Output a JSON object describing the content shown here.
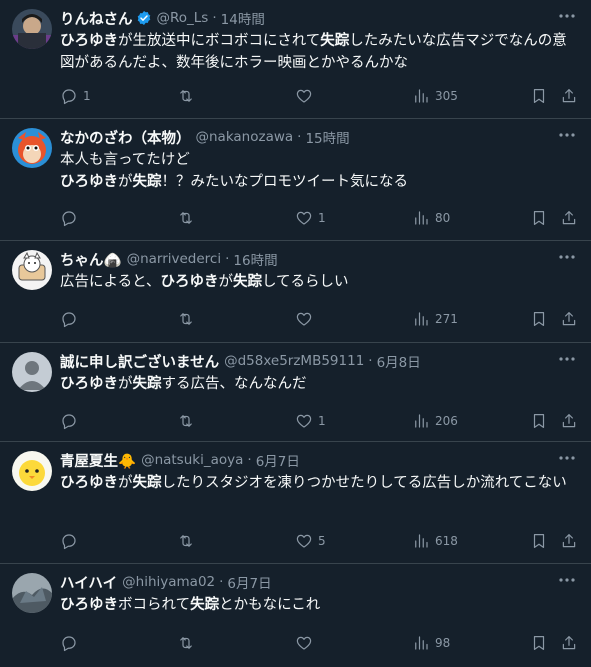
{
  "tweets": [
    {
      "name": "りんねさん",
      "verified": true,
      "handle": "@Ro_Ls",
      "time": "14時間",
      "segments": [
        {
          "text": "ひろゆき",
          "bold": true
        },
        {
          "text": "が生放送中にボコボコにされて",
          "bold": false
        },
        {
          "text": "失踪",
          "bold": true
        },
        {
          "text": "したみたいな広告マジでなんの意図があるんだよ、数年後にホラー映画とかやるんかな",
          "bold": false
        }
      ],
      "reply_count": "1",
      "retweet_count": "",
      "like_count": "",
      "view_count": "305",
      "avatar_color": "#3a4a5c"
    },
    {
      "name": "なかのざわ（本物）",
      "verified": false,
      "handle": "@nakanozawa",
      "time": "15時間",
      "segments": [
        {
          "text": "本人も言ってたけど\n",
          "bold": false
        },
        {
          "text": "ひろゆき",
          "bold": true
        },
        {
          "text": "が",
          "bold": false
        },
        {
          "text": "失踪",
          "bold": true
        },
        {
          "text": "！？みたいなプロモツイート気になる",
          "bold": false
        }
      ],
      "reply_count": "",
      "retweet_count": "",
      "like_count": "1",
      "view_count": "80",
      "avatar_color": "#2b8fd6"
    },
    {
      "name": "ちゃん🍙",
      "verified": false,
      "handle": "@narrivederci",
      "time": "16時間",
      "segments": [
        {
          "text": "広告によると、",
          "bold": false
        },
        {
          "text": "ひろゆき",
          "bold": true
        },
        {
          "text": "が",
          "bold": false
        },
        {
          "text": "失踪",
          "bold": true
        },
        {
          "text": "してるらしい",
          "bold": false
        }
      ],
      "reply_count": "",
      "retweet_count": "",
      "like_count": "",
      "view_count": "271",
      "avatar_color": "#f4f4f4"
    },
    {
      "name": "誠に申し訳ございません",
      "verified": false,
      "handle": "@d58xe5rzMB59111",
      "time": "6月8日",
      "segments": [
        {
          "text": "ひろゆき",
          "bold": true
        },
        {
          "text": "が",
          "bold": false
        },
        {
          "text": "失踪",
          "bold": true
        },
        {
          "text": "する広告、なんなんだ",
          "bold": false
        }
      ],
      "reply_count": "",
      "retweet_count": "",
      "like_count": "1",
      "view_count": "206",
      "avatar_color": "#c4ccd4"
    },
    {
      "name": "青屋夏生🐥",
      "verified": false,
      "handle": "@natsuki_aoya",
      "time": "6月7日",
      "segments": [
        {
          "text": "ひろゆき",
          "bold": true
        },
        {
          "text": "が",
          "bold": false
        },
        {
          "text": "失踪",
          "bold": true
        },
        {
          "text": "したりスタジオを凍りつかせたりしてる広告しか流れてこない",
          "bold": false
        }
      ],
      "reply_count": "",
      "retweet_count": "",
      "like_count": "5",
      "view_count": "618",
      "avatar_color": "#f8f8f0"
    },
    {
      "name": "ハイハイ",
      "verified": false,
      "handle": "@hihiyama02",
      "time": "6月7日",
      "segments": [
        {
          "text": "ひろゆき",
          "bold": true
        },
        {
          "text": "ボコられて",
          "bold": false
        },
        {
          "text": "失踪",
          "bold": true
        },
        {
          "text": "とかもなにこれ",
          "bold": false
        }
      ],
      "reply_count": "",
      "retweet_count": "",
      "like_count": "",
      "view_count": "98",
      "avatar_color": "#6a7a86"
    }
  ],
  "separator": "·",
  "icons": {
    "reply": "reply-icon",
    "retweet": "retweet-icon",
    "like": "like-icon",
    "views": "views-icon",
    "bookmark": "bookmark-icon",
    "share": "share-icon",
    "more": "more-icon",
    "verified": "verified-badge-icon"
  },
  "colors": {
    "background": "#15202b",
    "text": "#f7f9f9",
    "muted": "#8b98a5",
    "border": "#38444d",
    "verified": "#1d9bf0"
  }
}
